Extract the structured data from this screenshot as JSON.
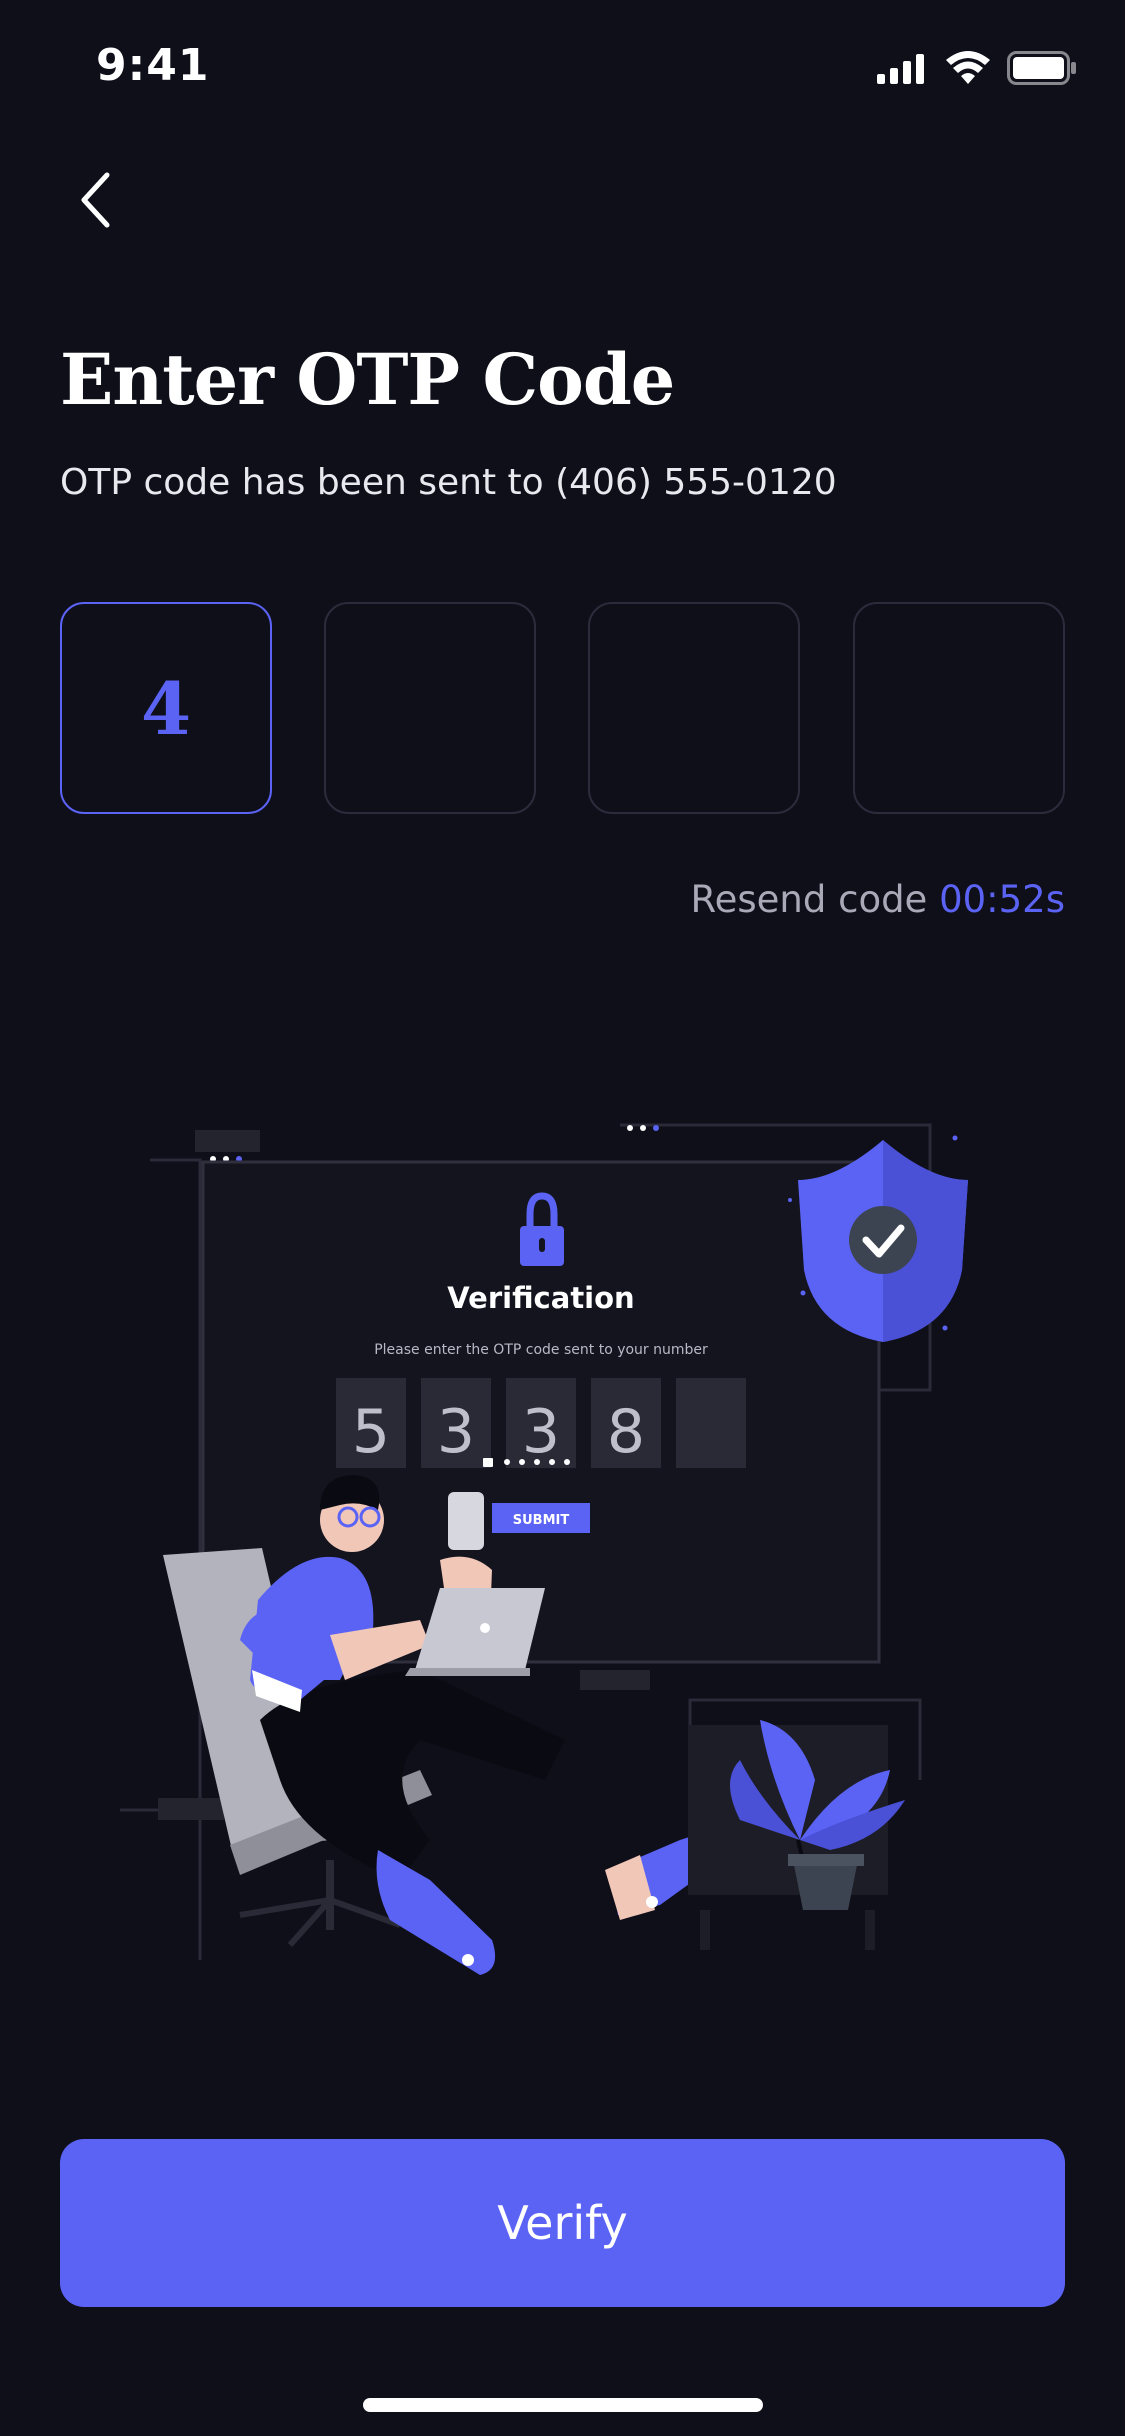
{
  "status_bar": {
    "time": "9:41",
    "icons": [
      "cellular-signal-icon",
      "wifi-icon",
      "battery-icon"
    ]
  },
  "header": {
    "back_icon": "chevron-left-icon",
    "title": "Enter OTP Code",
    "subtitle": "OTP code has been sent to (406) 555-0120"
  },
  "otp": {
    "digits": [
      "4",
      "",
      "",
      ""
    ],
    "active_index": 0
  },
  "resend": {
    "label": "Resend code",
    "timer": "00:52s"
  },
  "illustration": {
    "heading": "Verification",
    "instruction": "Please enter the OTP code sent to your number",
    "code_digits": [
      "5",
      "3",
      "3",
      "8",
      ""
    ],
    "submit_label": "SUBMIT",
    "icons": [
      "padlock-icon",
      "shield-check-icon",
      "plant-icon",
      "laptop-icon",
      "phone-icon"
    ]
  },
  "actions": {
    "verify_label": "Verify"
  },
  "colors": {
    "background": "#0f0f1a",
    "accent": "#5b63f5",
    "box_border": "#2b2b3c",
    "muted_text": "#a9a9b8"
  }
}
